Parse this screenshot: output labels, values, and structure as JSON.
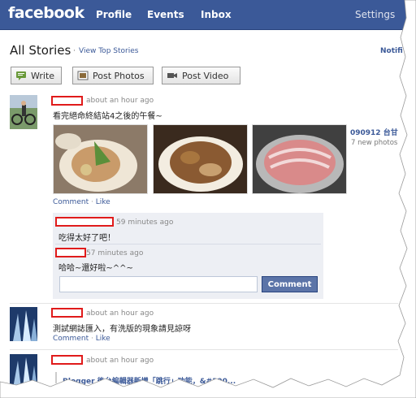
{
  "topbar": {
    "logo": "facebook",
    "nav": {
      "profile": "Profile",
      "events": "Events",
      "inbox": "Inbox",
      "settings": "Settings"
    }
  },
  "heading": {
    "title": "All Stories",
    "dot": "·",
    "view_top": "View Top Stories",
    "notifications": "Notifi"
  },
  "publisher": {
    "write": "Write",
    "photos": "Post Photos",
    "video": "Post Video"
  },
  "stories": [
    {
      "time": "about an hour ago",
      "text": "看完絕命終結站4之後的午餐~",
      "album_title": "090912 台甘",
      "album_count": "7 new photos",
      "actions": {
        "comment": "Comment",
        "sep": "·",
        "like": "Like"
      },
      "comments": [
        {
          "time": "59 minutes ago",
          "text": "吃得太好了吧！"
        },
        {
          "time": "57 minutes ago",
          "text": "哈哈~還好啦~^^~"
        }
      ],
      "comment_button": "Comment"
    },
    {
      "time": "about an hour ago",
      "text": "測試網誌匯入，有洗版的現象請見諒呀",
      "actions": {
        "comment": "Comment",
        "sep": "·",
        "like": "Like"
      }
    },
    {
      "time": "about an hour ago",
      "link": "Blogger 後台編輯器新增「跳行」功能，&#390..."
    }
  ],
  "colors": {
    "brand": "#3b5998",
    "redaction": "#e01b1b",
    "comment_bg": "#edeff4",
    "button": "#5b74a8"
  }
}
